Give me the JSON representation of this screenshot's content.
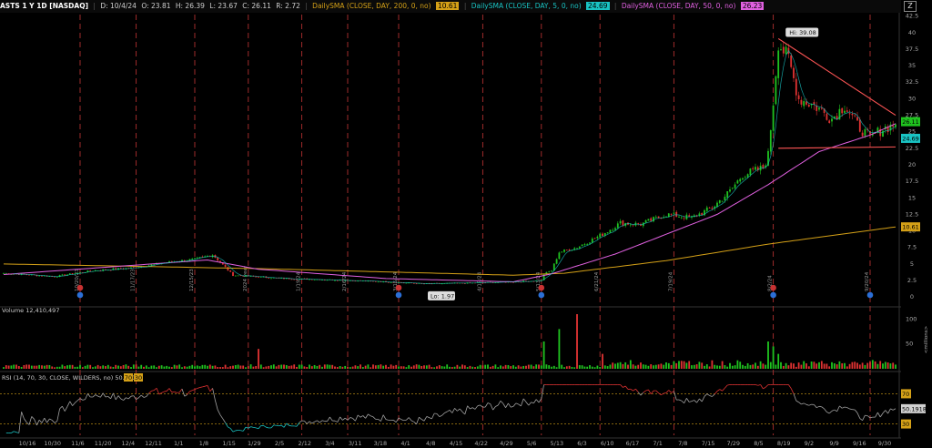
{
  "header": {
    "symbol": "ASTS 1 Y 1D [NASDAQ]",
    "date": "D: 10/4/24",
    "open": "O: 23.81",
    "high": "H: 26.39",
    "low": "L: 23.67",
    "close": "C: 26.11",
    "range": "R: 2.72",
    "sma200_label": "DailySMA (CLOSE, DAY, 200, 0, no)",
    "sma200_value": "10.61",
    "sma5_label": "DailySMA (CLOSE, DAY, 5, 0, no)",
    "sma5_value": "24.69",
    "sma50_label": "DailySMA (CLOSE, DAY, 50, 0, no)",
    "sma50_value": "26.23"
  },
  "volume_panel": {
    "label": "Volume",
    "value": "12,410,497",
    "axis_unit": "<millions>"
  },
  "rsi_panel": {
    "label": "RSI (14, 70, 30, CLOSE, WILDERS, no)",
    "value": "50.1918",
    "ob": "70",
    "os": "30"
  },
  "price_flags": {
    "last": "26.11",
    "sma5": "24.69",
    "sma200": "10.61"
  },
  "callouts": {
    "hi": "Hi: 39.08",
    "lo": "Lo: 1.97"
  },
  "colors": {
    "up": "#1fc31f",
    "down": "#e03232",
    "sma200": "#d4a017",
    "sma5": "#19c3c3",
    "sma50": "#e060e0",
    "trend": "#ff5555",
    "event_line": "#b03030",
    "rsi": "#a0a0a0"
  },
  "chart_data": {
    "type": "candlestick",
    "price_axis": {
      "ticks": [
        "0",
        "2.5",
        "5",
        "7.5",
        "10",
        "12.5",
        "15",
        "17.5",
        "20",
        "22.5",
        "25",
        "27.5",
        "30",
        "32.5",
        "35",
        "37.5",
        "40",
        "42.5"
      ],
      "range": [
        -0.8,
        43
      ]
    },
    "volume_axis": {
      "ticks": [
        "100",
        "50"
      ],
      "range": [
        0,
        110
      ]
    },
    "rsi_axis": {
      "ticks": [
        "70",
        "50.1918",
        "30"
      ],
      "range": [
        15,
        85
      ]
    },
    "x_labels": [
      "10/16",
      "10/30",
      "11/6",
      "11/20",
      "12/4",
      "12/11",
      "1/1",
      "1/8",
      "1/15",
      "1/29",
      "2/5",
      "2/12",
      "3/4",
      "3/11",
      "3/18",
      "4/1",
      "4/8",
      "4/15",
      "4/22",
      "4/29",
      "5/6",
      "5/13",
      "6/3",
      "6/10",
      "6/17",
      "7/1",
      "7/8",
      "7/15",
      "7/29",
      "8/5",
      "8/19",
      "9/2",
      "9/9",
      "9/16",
      "9/30"
    ],
    "event_labels": [
      "10/20/23",
      "11/17/23",
      "12/15/23",
      "2024 year",
      "1/19/24",
      "2/16/24",
      "3/15/24",
      "4/19/24",
      "5/13/24",
      "6/21/24",
      "7/19/24",
      "8/2/24",
      "9/20/24"
    ],
    "anchors": [
      [
        0,
        3.6
      ],
      [
        20,
        3.1
      ],
      [
        35,
        4.0
      ],
      [
        50,
        4.4
      ],
      [
        65,
        5.3
      ],
      [
        75,
        5.7
      ],
      [
        82,
        6.4
      ],
      [
        90,
        3.3
      ],
      [
        110,
        2.8
      ],
      [
        130,
        2.6
      ],
      [
        150,
        2.3
      ],
      [
        165,
        2.0
      ],
      [
        180,
        2.1
      ],
      [
        200,
        2.3
      ],
      [
        211,
        2.5
      ],
      [
        212,
        3.5
      ],
      [
        215,
        4.0
      ],
      [
        218,
        6.8
      ],
      [
        225,
        7.5
      ],
      [
        235,
        9.5
      ],
      [
        242,
        11.2
      ],
      [
        250,
        11.0
      ],
      [
        260,
        12.5
      ],
      [
        270,
        12.0
      ],
      [
        278,
        13.5
      ],
      [
        285,
        16.0
      ],
      [
        290,
        18.5
      ],
      [
        298,
        19.5
      ],
      [
        300,
        21.5
      ],
      [
        302,
        29.5
      ],
      [
        304,
        38.5
      ],
      [
        308,
        36.0
      ],
      [
        312,
        30.0
      ],
      [
        318,
        29.0
      ],
      [
        325,
        27.0
      ],
      [
        330,
        29.0
      ],
      [
        335,
        26.0
      ],
      [
        340,
        24.0
      ],
      [
        345,
        25.5
      ],
      [
        350,
        26.11
      ]
    ],
    "volume_spikes": [
      [
        100,
        40
      ],
      [
        212,
        55
      ],
      [
        218,
        80
      ],
      [
        225,
        110
      ],
      [
        235,
        30
      ],
      [
        300,
        55
      ],
      [
        302,
        45
      ],
      [
        304,
        30
      ]
    ],
    "sma200": [
      [
        0,
        5.0
      ],
      [
        100,
        4.3
      ],
      [
        200,
        3.3
      ],
      [
        220,
        3.6
      ],
      [
        260,
        5.5
      ],
      [
        300,
        8.0
      ],
      [
        350,
        10.61
      ]
    ],
    "sma50": [
      [
        0,
        3.4
      ],
      [
        80,
        5.6
      ],
      [
        100,
        4.2
      ],
      [
        150,
        2.8
      ],
      [
        200,
        2.3
      ],
      [
        215,
        3.5
      ],
      [
        240,
        6.5
      ],
      [
        280,
        12.5
      ],
      [
        300,
        17.0
      ],
      [
        320,
        22.0
      ],
      [
        340,
        24.5
      ],
      [
        350,
        26.23
      ]
    ],
    "trendline_down": [
      [
        304,
        39.08
      ],
      [
        350,
        27.5
      ]
    ],
    "support": [
      [
        304,
        22.5
      ],
      [
        350,
        22.7
      ]
    ]
  }
}
